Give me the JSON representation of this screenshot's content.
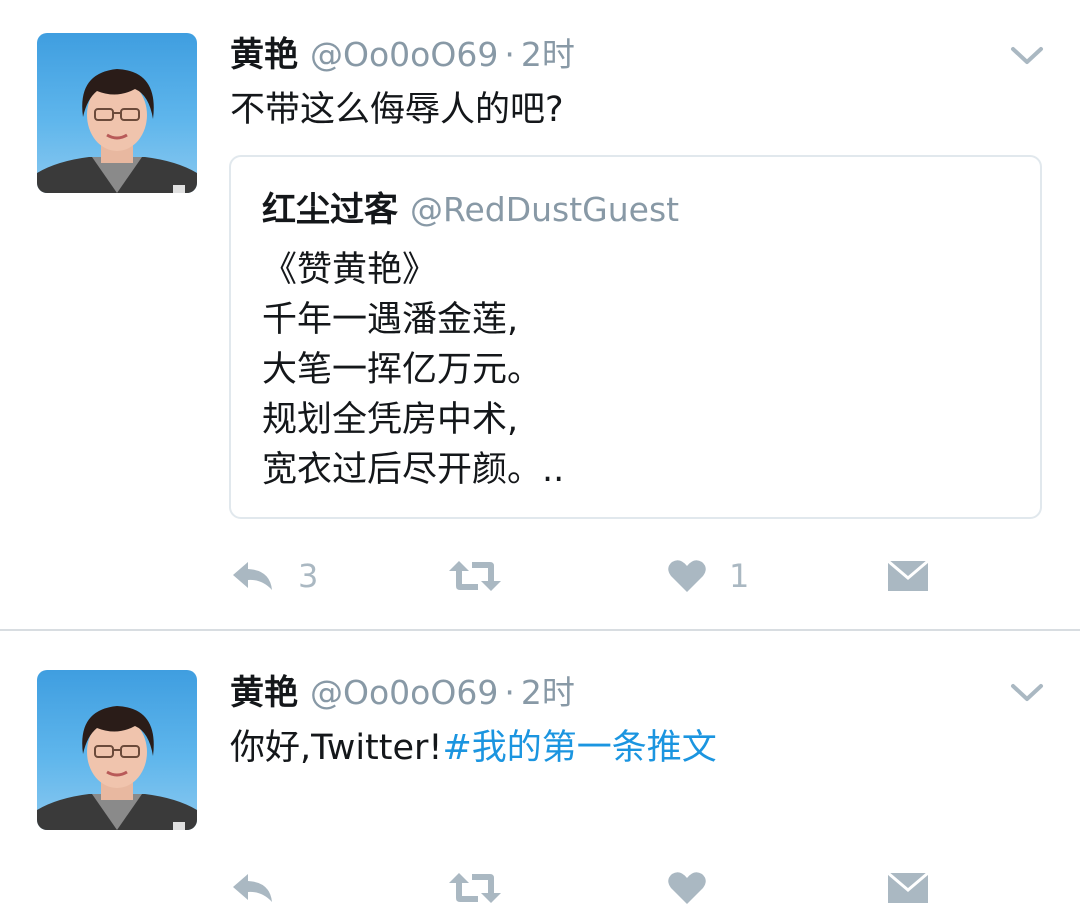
{
  "tweets": [
    {
      "author": {
        "display_name": "黄艳",
        "handle": "@Oo0oO69",
        "separator": "·",
        "time": "2时"
      },
      "text": "不带这么侮辱人的吧?",
      "quoted": {
        "display_name": "红尘过客",
        "handle": "@RedDustGuest",
        "lines": [
          "《赞黄艳》",
          "千年一遇潘金莲,",
          "大笔一挥亿万元。",
          "规划全凭房中术,",
          "宽衣过后尽开颜。.."
        ]
      },
      "actions": {
        "reply_count": "3",
        "retweet_count": "",
        "like_count": "1"
      }
    },
    {
      "author": {
        "display_name": "黄艳",
        "handle": "@Oo0oO69",
        "separator": "·",
        "time": "2时"
      },
      "text": "你好,Twitter!",
      "hashtag": "#我的第一条推文",
      "actions": {
        "reply_count": "",
        "retweet_count": "",
        "like_count": ""
      }
    }
  ],
  "colors": {
    "name": "#14171a",
    "muted": "#8899a6",
    "icon": "#aab8c2",
    "link": "#1b95e0",
    "border": "#e1e8ed"
  },
  "icons": [
    "chevron-down-icon",
    "reply-icon",
    "retweet-icon",
    "heart-icon",
    "direct-message-icon"
  ]
}
